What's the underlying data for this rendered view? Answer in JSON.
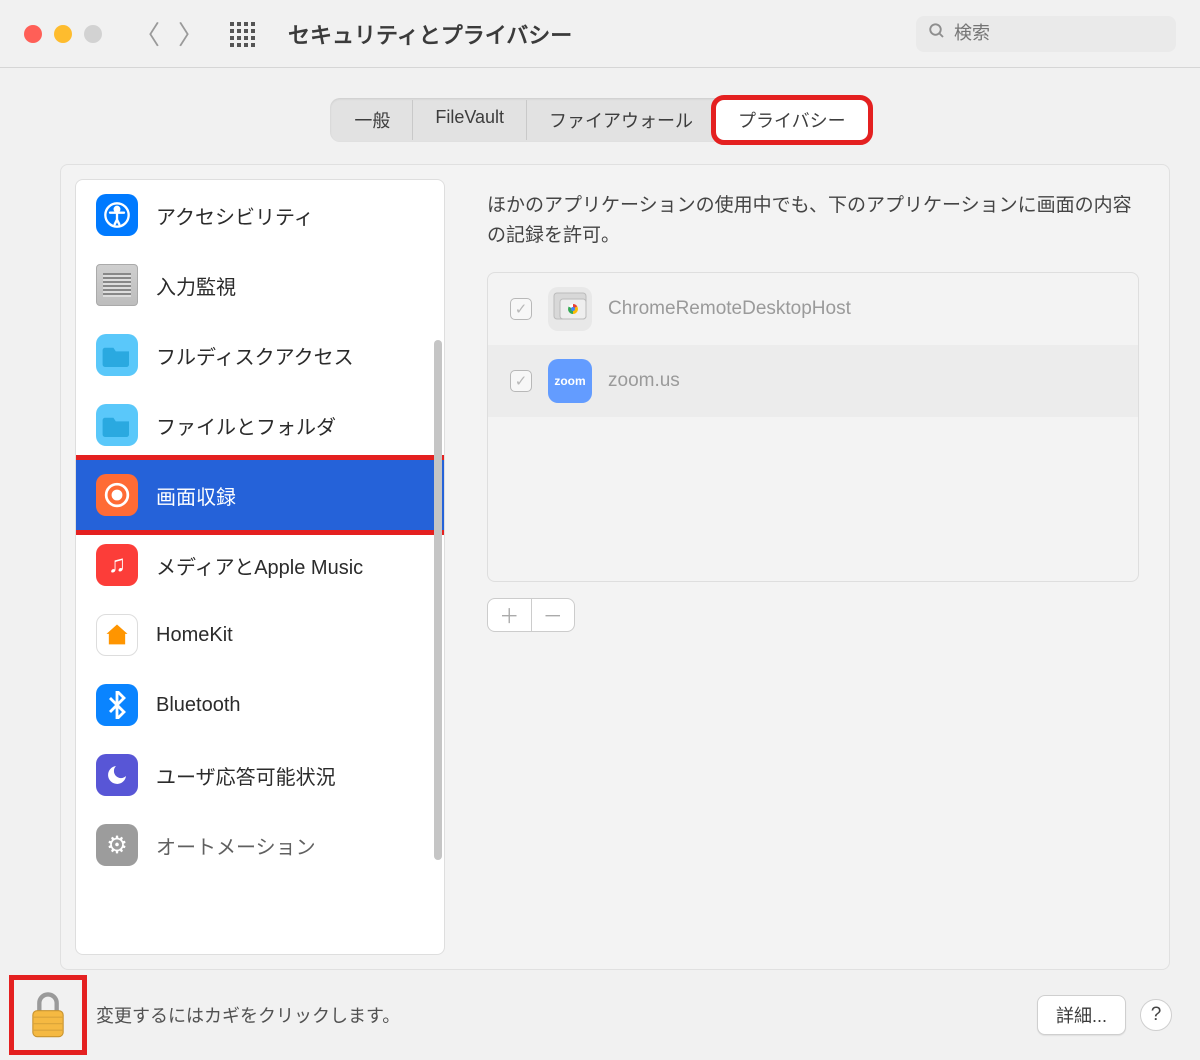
{
  "window": {
    "title": "セキュリティとプライバシー",
    "search_placeholder": "検索"
  },
  "tabs": [
    "一般",
    "FileVault",
    "ファイアウォール",
    "プライバシー"
  ],
  "selected_tab": "プライバシー",
  "sidebar": {
    "items": [
      {
        "icon": "accessibility-icon",
        "label": "アクセシビリティ"
      },
      {
        "icon": "keyboard-icon",
        "label": "入力監視"
      },
      {
        "icon": "folder-icon",
        "label": "フルディスクアクセス"
      },
      {
        "icon": "files-folder-icon",
        "label": "ファイルとフォルダ"
      },
      {
        "icon": "screen-record-icon",
        "label": "画面収録",
        "selected": true
      },
      {
        "icon": "music-icon",
        "label": "メディアとApple Music"
      },
      {
        "icon": "home-icon",
        "label": "HomeKit"
      },
      {
        "icon": "bluetooth-icon",
        "label": "Bluetooth"
      },
      {
        "icon": "moon-icon",
        "label": "ユーザ応答可能状況"
      },
      {
        "icon": "gear-icon",
        "label": "オートメーション"
      }
    ]
  },
  "main": {
    "description": "ほかのアプリケーションの使用中でも、下のアプリケーションに画面の内容の記録を許可。",
    "apps": [
      {
        "name": "ChromeRemoteDesktopHost",
        "checked": true,
        "icon": "chrome-remote-icon"
      },
      {
        "name": "zoom.us",
        "checked": true,
        "icon": "zoom-icon"
      }
    ]
  },
  "footer": {
    "lock_text": "変更するにはカギをクリックします。",
    "advanced_label": "詳細...",
    "help_label": "?"
  }
}
